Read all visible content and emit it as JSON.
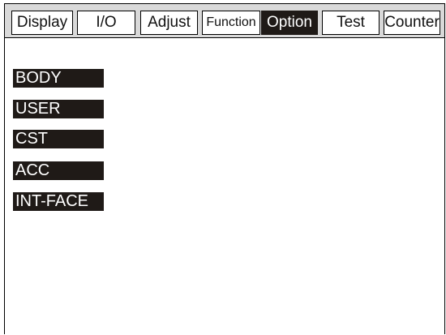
{
  "tabs": [
    {
      "label": "Display",
      "active": false
    },
    {
      "label": "I/O",
      "active": false
    },
    {
      "label": "Adjust",
      "active": false
    },
    {
      "label": "Function",
      "active": false
    },
    {
      "label": "Option",
      "active": true
    },
    {
      "label": "Test",
      "active": false
    },
    {
      "label": "Counter",
      "active": false
    }
  ],
  "option_menu": {
    "items": [
      {
        "label": "BODY"
      },
      {
        "label": "USER"
      },
      {
        "label": "CST"
      },
      {
        "label": "ACC"
      },
      {
        "label": "INT-FACE"
      }
    ]
  },
  "colors": {
    "tab_bar": "#d9d9d9",
    "active_tab": "#1f1a17",
    "menu_item_bg": "#1f1a17",
    "menu_item_text": "#ffffff"
  }
}
